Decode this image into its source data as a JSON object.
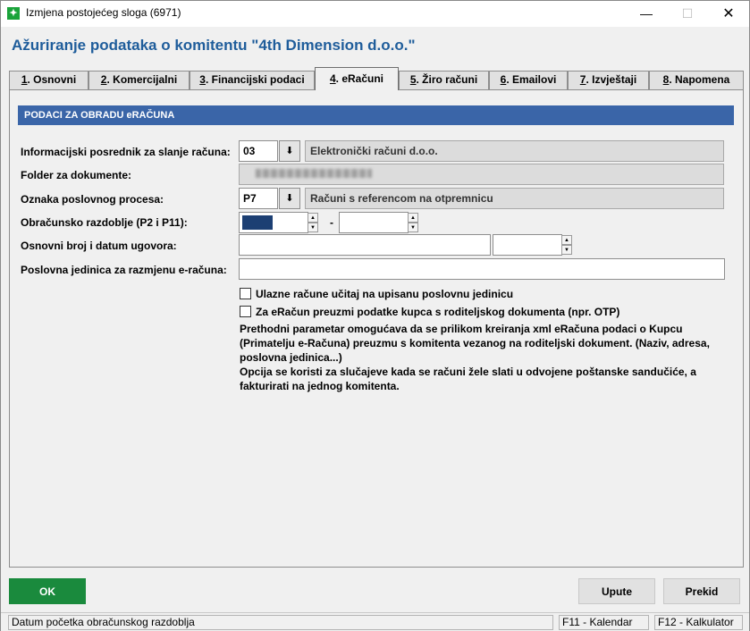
{
  "window": {
    "title": "Izmjena postojećeg sloga (6971)",
    "minimize": "—",
    "maximize": "☐",
    "close": "✕"
  },
  "page_title": "Ažuriranje podataka o komitentu \"4th Dimension d.o.o.\"",
  "tabs": [
    {
      "num": "1",
      "label": ". Osnovni"
    },
    {
      "num": "2",
      "label": ". Komercijalni"
    },
    {
      "num": "3",
      "label": ". Financijski podaci"
    },
    {
      "num": "4",
      "label": ". eRačuni"
    },
    {
      "num": "5",
      "label": ". Žiro računi"
    },
    {
      "num": "6",
      "label": ". Emailovi"
    },
    {
      "num": "7",
      "label": ". Izvještaji"
    },
    {
      "num": "8",
      "label": ". Napomena"
    }
  ],
  "active_tab": "4",
  "section": {
    "header": "PODACI ZA OBRADU eRAČUNA"
  },
  "fields": {
    "posrednik": {
      "label": "Informacijski posrednik za slanje računa:",
      "code": "03",
      "name": "Elektronički računi d.o.o."
    },
    "folder": {
      "label": "Folder za dokumente:",
      "value": ""
    },
    "proces": {
      "label": "Oznaka poslovnog procesa:",
      "code": "P7",
      "name": "Računi s referencom na otpremnicu"
    },
    "razdoblje": {
      "label": "Obračunsko razdoblje (P2 i P11):",
      "separator": "-",
      "from": "",
      "to": ""
    },
    "ugovor": {
      "label": "Osnovni broj i datum ugovora:",
      "number": "",
      "date": ""
    },
    "jedinica": {
      "label": "Poslovna jedinica za razmjenu e-računa:",
      "value": ""
    }
  },
  "checkboxes": [
    {
      "label": "Ulazne račune učitaj na upisanu poslovnu jedinicu",
      "checked": false
    },
    {
      "label": "Za eRačun preuzmi podatke kupca s roditeljskog dokumenta (npr. OTP)",
      "checked": false
    }
  ],
  "description": {
    "line1": "Prethodni parametar omogućava da se prilikom kreiranja xml eRačuna podaci o Kupcu (Primatelju e-Računa) preuzmu s komitenta vezanog na roditeljski dokument. (Naziv, adresa, poslovna jedinica...)",
    "line2": "Opcija se koristi za slučajeve kada se računi žele slati u odvojene poštanske sandučiće, a fakturirati na jednog komitenta."
  },
  "buttons": {
    "ok": "OK",
    "upute": "Upute",
    "prekid": "Prekid"
  },
  "statusbar": {
    "message": "Datum početka obračunskog razdoblja",
    "f11": "F11 - Kalendar",
    "f12": "F12 - Kalkulator"
  },
  "colors": {
    "title_blue": "#1f5d9b",
    "section_blue": "#3a65a8",
    "ok_green": "#1a8a3d",
    "focus_fill": "#1c3f73"
  },
  "icons": {
    "app": "app-icon",
    "dropdown": "download-arrow-icon",
    "spinner": "spin-updown-icon"
  }
}
